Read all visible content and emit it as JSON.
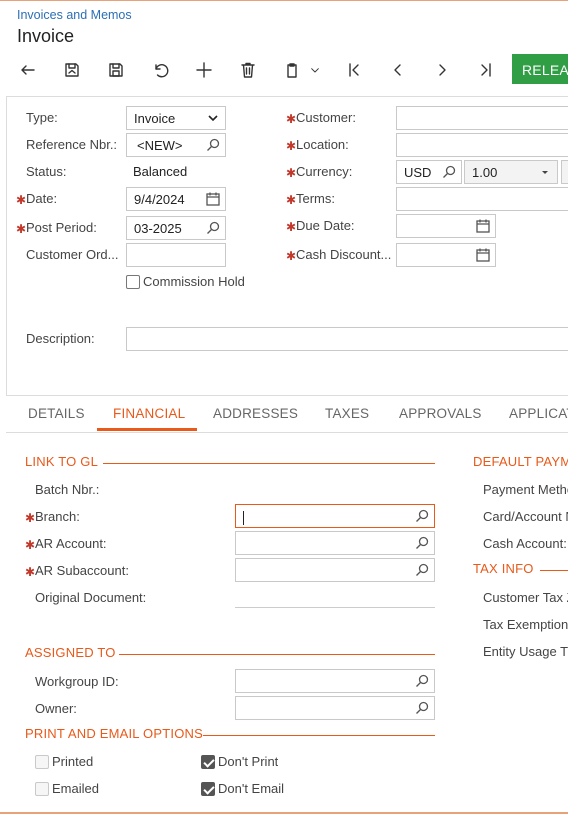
{
  "header": {
    "breadcrumb": "Invoices and Memos",
    "title": "Invoice"
  },
  "toolbar": {
    "release_label": "RELEA",
    "icons": [
      "back-icon",
      "save-and-close-icon",
      "save-icon",
      "undo-icon",
      "add-icon",
      "delete-icon",
      "copy-paste-icon",
      "first-icon",
      "previous-icon",
      "next-icon",
      "last-icon"
    ]
  },
  "summary": {
    "type": {
      "label": "Type:",
      "value": "Invoice"
    },
    "reference": {
      "label": "Reference Nbr.:",
      "value": "<NEW>"
    },
    "status": {
      "label": "Status:",
      "value": "Balanced"
    },
    "date": {
      "label": "Date:",
      "value": "9/4/2024"
    },
    "post_period": {
      "label": "Post Period:",
      "value": "03-2025"
    },
    "customer_order": {
      "label": "Customer Ord...",
      "value": ""
    },
    "commission_hold": {
      "label": "Commission Hold",
      "checked": false
    },
    "customer": {
      "label": "Customer:",
      "value": ""
    },
    "location": {
      "label": "Location:",
      "value": ""
    },
    "currency": {
      "label": "Currency:",
      "value": "USD",
      "rate": "1.00"
    },
    "terms": {
      "label": "Terms:",
      "value": ""
    },
    "due_date": {
      "label": "Due Date:",
      "value": ""
    },
    "cash_discount": {
      "label": "Cash Discount...",
      "value": ""
    },
    "description": {
      "label": "Description:",
      "value": ""
    }
  },
  "tabs": [
    {
      "label": "DETAILS",
      "active": false
    },
    {
      "label": "FINANCIAL",
      "active": true
    },
    {
      "label": "ADDRESSES",
      "active": false
    },
    {
      "label": "TAXES",
      "active": false
    },
    {
      "label": "APPROVALS",
      "active": false
    },
    {
      "label": "APPLICAT",
      "active": false
    }
  ],
  "financial": {
    "link_to_gl": {
      "title": "LINK TO GL",
      "batch_nbr": {
        "label": "Batch Nbr.:",
        "value": ""
      },
      "branch": {
        "label": "Branch:",
        "value": ""
      },
      "ar_account": {
        "label": "AR Account:",
        "value": ""
      },
      "ar_subaccount": {
        "label": "AR Subaccount:",
        "value": ""
      },
      "original_document": {
        "label": "Original Document:",
        "value": ""
      }
    },
    "assigned_to": {
      "title": "ASSIGNED TO",
      "workgroup": {
        "label": "Workgroup ID:",
        "value": ""
      },
      "owner": {
        "label": "Owner:",
        "value": ""
      }
    },
    "print_email": {
      "title": "PRINT AND EMAIL OPTIONS",
      "printed": {
        "label": "Printed",
        "checked": false
      },
      "emailed": {
        "label": "Emailed",
        "checked": false
      },
      "dont_print": {
        "label": "Don't Print",
        "checked": true
      },
      "dont_email": {
        "label": "Don't Email",
        "checked": true
      }
    },
    "default_payment": {
      "title": "DEFAULT PAYM",
      "payment_method": "Payment Metho",
      "card_account": "Card/Account N",
      "cash_account": "Cash Account:"
    },
    "tax_info": {
      "title": "TAX INFO",
      "customer_tax": "Customer Tax Z",
      "tax_exemption": "Tax Exemption",
      "entity_usage": "Entity Usage T"
    }
  },
  "colors": {
    "accent": "#e8591a",
    "release": "#2f9e44",
    "link": "#2d6fb3",
    "required": "#c0392b"
  }
}
